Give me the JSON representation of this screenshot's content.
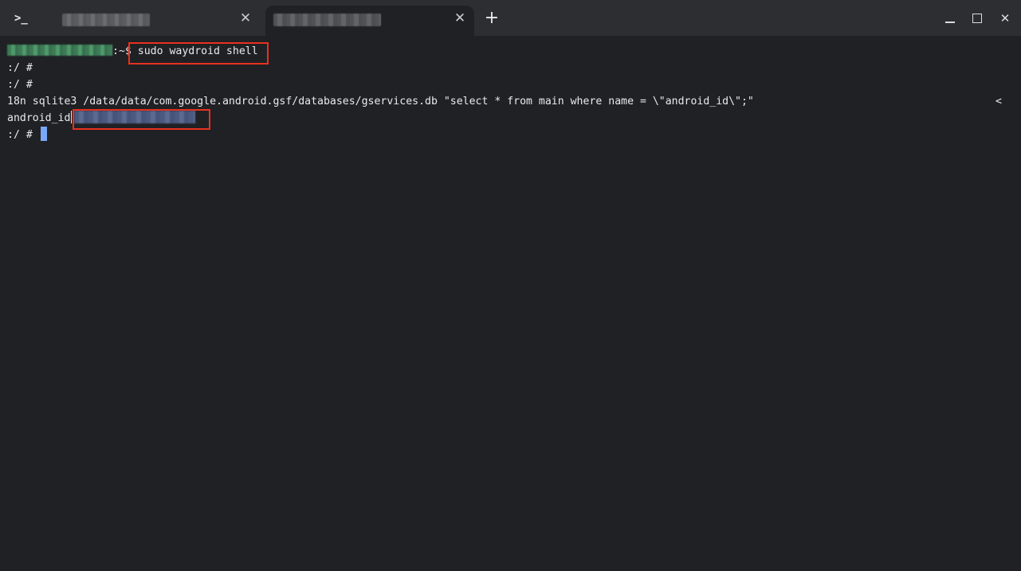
{
  "app_icon_glyph": ">_",
  "tabs": [
    {
      "title": "",
      "close_glyph": "✕",
      "active": false
    },
    {
      "title": "",
      "close_glyph": "✕",
      "active": true
    }
  ],
  "new_tab_glyph": "+",
  "window_controls": {
    "minimize_icon": "minimize-icon",
    "maximize_icon": "maximize-icon",
    "close_glyph": "✕"
  },
  "terminal": {
    "prompt_user_host": "",
    "prompt_suffix": ":~$",
    "command": "sudo waydroid shell",
    "line2": ":/ #",
    "line3": ":/ #",
    "line4": "18n sqlite3 /data/data/com.google.android.gsf/databases/gservices.db \"select * from main where name = \\\"android_id\\\";\"",
    "wrap_marker": "<",
    "line5_label": "android_id",
    "line5_value": "",
    "line6": ":/ #"
  },
  "colors": {
    "background": "#202124",
    "tabbar": "#2d2e31",
    "text": "#e8eaed",
    "highlight_box": "#e8311f",
    "cursor": "#7aa7f5"
  }
}
